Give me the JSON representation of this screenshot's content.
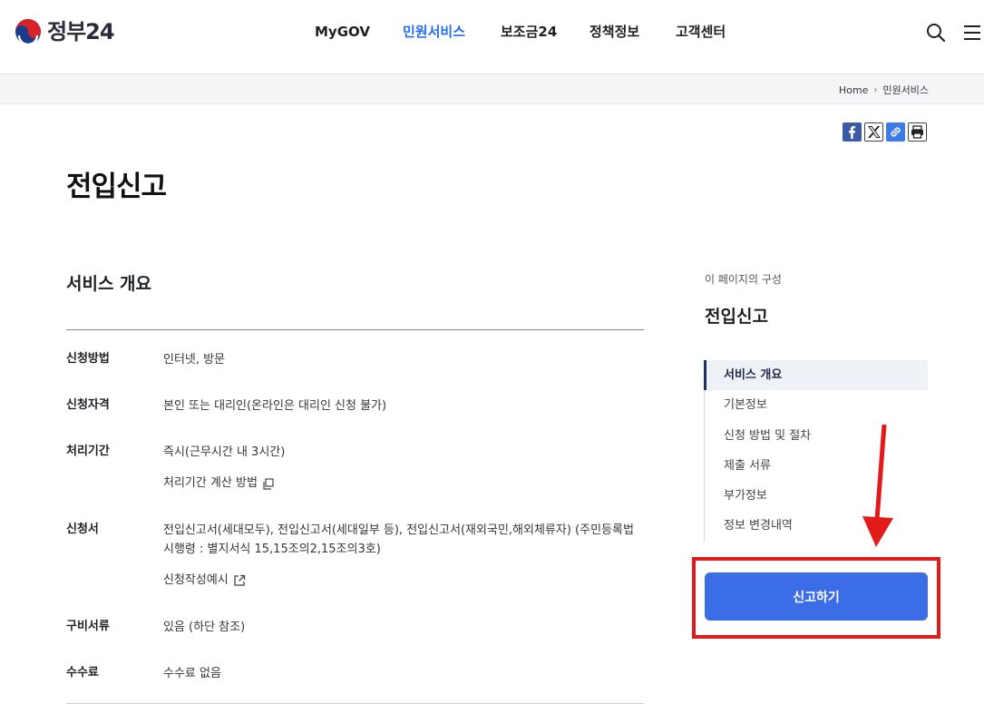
{
  "header": {
    "logo_text": "정부24",
    "menu": [
      "MyGOV",
      "민원서비스",
      "보조금24",
      "정책정보",
      "고객센터"
    ],
    "active_menu": "민원서비스",
    "icons": [
      "search-icon",
      "hamburger-menu-icon"
    ]
  },
  "breadcrumb": {
    "items": [
      "Home",
      "민원서비스"
    ]
  },
  "share": {
    "icons": [
      "facebook-icon",
      "x-icon",
      "link-icon",
      "print-icon"
    ],
    "colors": {
      "facebook": "#3b5ba6",
      "link": "#3c7be8"
    }
  },
  "page": {
    "title": "전입신고"
  },
  "overview": {
    "section_title": "서비스 개요",
    "rows": [
      {
        "label": "신청방법",
        "value": "인터넷, 방문"
      },
      {
        "label": "신청자격",
        "value": "본인 또는 대리인(온라인은 대리인 신청 불가)"
      },
      {
        "label": "처리기간",
        "value": "즉시(근무시간 내 3시간)",
        "link": "처리기간 계산 방법"
      },
      {
        "label": "신청서",
        "value": "전입신고서(세대모두), 전입신고서(세대일부 등), 전입신고서(재외국민,해외체류자) (주민등록법 시행령 : 별지서식 15,15조의2,15조의3호)",
        "link": "신청작성예시"
      },
      {
        "label": "구비서류",
        "value": "있음 (하단 참조)"
      },
      {
        "label": "수수료",
        "value": "수수료 없음"
      }
    ]
  },
  "toc": {
    "caption": "이 페이지의 구성",
    "title": "전입신고",
    "items": [
      "서비스 개요",
      "기본정보",
      "신청 방법 및 절차",
      "제출 서류",
      "부가정보",
      "정보 변경내역"
    ],
    "active_index": 0
  },
  "action": {
    "apply_label": "신고하기",
    "color": "#3b6ee6"
  },
  "annotation": {
    "color": "#e11a1a"
  }
}
